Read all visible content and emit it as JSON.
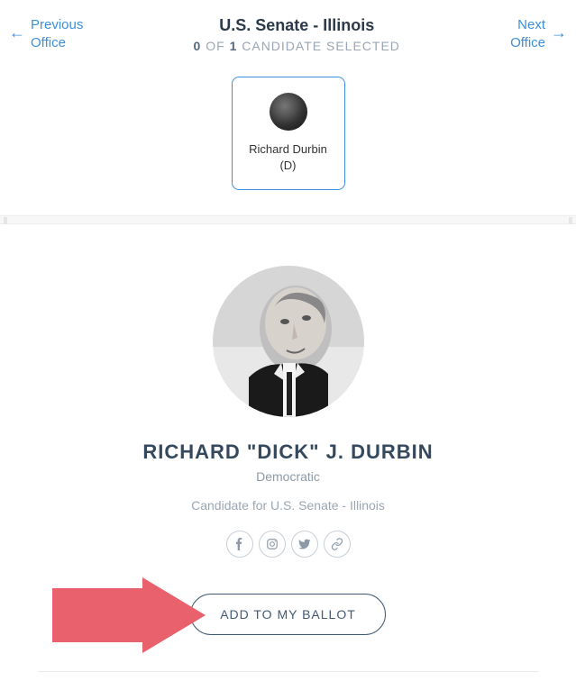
{
  "nav": {
    "prev": "Previous\nOffice",
    "next": "Next\nOffice"
  },
  "office": {
    "title": "U.S. Senate - Illinois",
    "selected_count": "0",
    "total_count": "1",
    "of_label": "OF",
    "selected_label": "CANDIDATE SELECTED"
  },
  "card": {
    "name": "Richard Durbin (D)"
  },
  "profile": {
    "name": "RICHARD \"DICK\" J. DURBIN",
    "party": "Democratic",
    "role": "Candidate for U.S. Senate - Illinois"
  },
  "actions": {
    "add_ballot": "ADD TO MY BALLOT"
  }
}
